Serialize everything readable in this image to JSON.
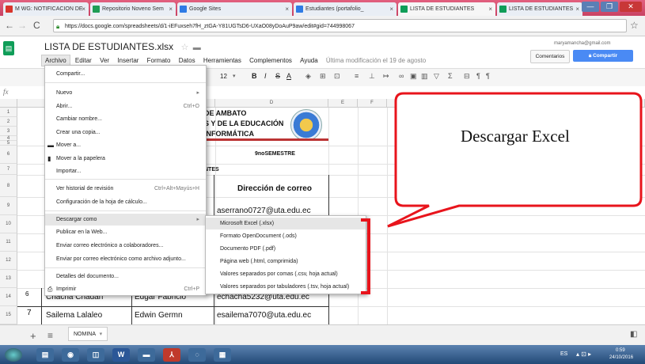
{
  "browser": {
    "tabs": [
      {
        "label": "M WG: NOTIFICACION DE",
        "color": "#d9352c"
      },
      {
        "label": "Repositorio Noveno Sem",
        "color": "#1f9d55"
      },
      {
        "label": "Google Sites",
        "color": "#2e7be5"
      },
      {
        "label": "Estudiantes (portafolio_",
        "color": "#2e7be5"
      },
      {
        "label": "LISTA DE ESTUDIANTES",
        "color": "#0f9d58"
      },
      {
        "label": "LISTA DE ESTUDIANTES",
        "color": "#0f9d58"
      }
    ],
    "url": "https://docs.google.com/spreadsheets/d/1-iEFuxseh7fH_ztGA-Y81UGTsD6-UXaO08yDoAuP9aw/edit#gid=744998067"
  },
  "sheets": {
    "logo": "▤",
    "title": "LISTA DE ESTUDIANTES.xlsx",
    "menu": [
      "Archivo",
      "Editar",
      "Ver",
      "Insertar",
      "Formato",
      "Datos",
      "Herramientas",
      "Complementos",
      "Ayuda"
    ],
    "last_edit": "Última modificación el 19 de agosto",
    "user_email": "maryamancha@gmail.com",
    "comments_label": "Comentarios",
    "share_label": "Compartir",
    "font_size": "12",
    "fx": "fx"
  },
  "grid": {
    "col_labels": [
      "D",
      "E",
      "F"
    ],
    "row_labels": [
      "1",
      "2",
      "3",
      "4",
      "5",
      "6",
      "7",
      "8",
      "9",
      "10",
      "11",
      "12",
      "13",
      "14",
      "15"
    ],
    "header_line1": "DE AMBATO",
    "header_line2": "S Y DE LA EDUCACIÓN",
    "header_line3": "INFORMÁTICA",
    "semester": "9noSEMESTRE",
    "ntes": "NTES",
    "email_header": "Dirección de correo",
    "row9_email": "aserrano0727@uta.edu.ec",
    "row14": {
      "num": "6",
      "apellido": "Chacha Chadan",
      "nombre": "Edgar Fabricio",
      "email": "echacha5232@uta.edu.ec"
    },
    "row15": {
      "num": "7",
      "apellido": "Sailema Lalaleo",
      "nombre": "Edwin Germn",
      "email": "esailema7070@uta.edu.ec"
    }
  },
  "file_menu": [
    {
      "label": "Compartir...",
      "shortcut": ""
    },
    {
      "label": "Nuevo",
      "shortcut": "▸"
    },
    {
      "label": "Abrir...",
      "shortcut": "Ctrl+O"
    },
    {
      "label": "Cambiar nombre...",
      "shortcut": ""
    },
    {
      "label": "Crear una copia...",
      "shortcut": ""
    },
    {
      "label": "Mover a...",
      "shortcut": ""
    },
    {
      "label": "Mover a la papelera",
      "shortcut": ""
    },
    {
      "label": "Importar...",
      "shortcut": ""
    },
    {
      "label": "Ver historial de revisión",
      "shortcut": "Ctrl+Alt+Mayús+H"
    },
    {
      "label": "Configuración de la hoja de cálculo...",
      "shortcut": ""
    },
    {
      "label": "Descargar como",
      "shortcut": "▸"
    },
    {
      "label": "Publicar en la Web...",
      "shortcut": ""
    },
    {
      "label": "Enviar correo electrónico a colaboradores...",
      "shortcut": ""
    },
    {
      "label": "Enviar por correo electrónico como archivo adjunto...",
      "shortcut": ""
    },
    {
      "label": "Detalles del documento...",
      "shortcut": ""
    },
    {
      "label": "Imprimir",
      "shortcut": "Ctrl+P"
    }
  ],
  "download_menu": [
    "Microsoft Excel (.xlsx)",
    "Formato OpenDocument (.ods)",
    "Documento PDF (.pdf)",
    "Página web (.html, comprimida)",
    "Valores separados por comas (.csv, hoja actual)",
    "Valores separados por tabuladores (.tsv, hoja actual)"
  ],
  "callout": {
    "text": "Descargar Excel",
    "border_color": "#e8141c"
  },
  "sheet_tab": {
    "add": "+",
    "list": "≡",
    "name": "NOMINA"
  },
  "taskbar": {
    "lang": "ES",
    "time": "0:59",
    "date": "24/10/2016"
  }
}
